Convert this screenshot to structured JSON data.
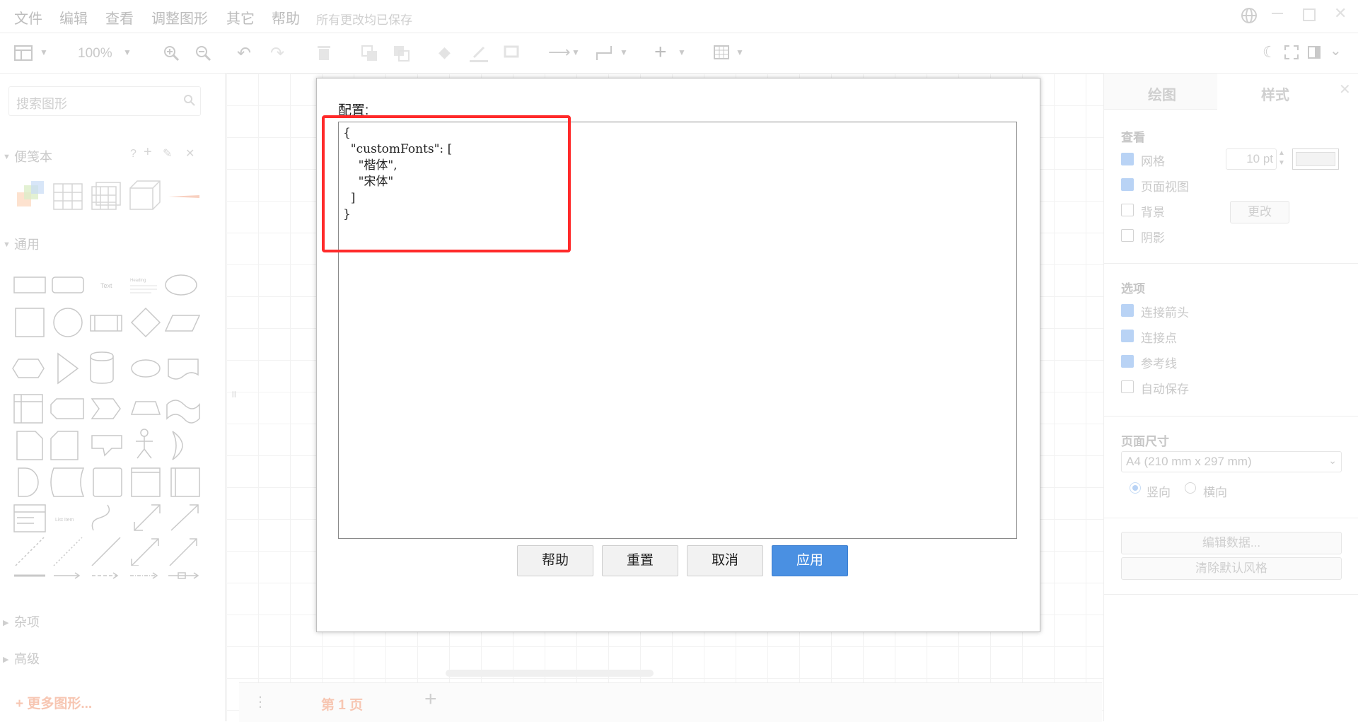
{
  "menubar": {
    "items": [
      "文件",
      "编辑",
      "查看",
      "调整图形",
      "其它",
      "帮助"
    ],
    "status": "所有更改均已保存"
  },
  "toolbar": {
    "zoom": "100%"
  },
  "left_panel": {
    "search_placeholder": "搜索图形",
    "sections": {
      "scratchpad": "便笺本",
      "general": "通用",
      "misc": "杂项",
      "advanced": "高级"
    },
    "scratchpad_help": "?",
    "shape_text": "Text",
    "shape_heading": "Heading",
    "shape_list_item": "List Item",
    "more_shapes": "+ 更多图形..."
  },
  "page_tabs": {
    "current": "第 1 页"
  },
  "right_panel": {
    "tabs": [
      "绘图",
      "样式"
    ],
    "view": {
      "title": "查看",
      "grid": "网格",
      "grid_size": "10 pt",
      "page_view": "页面视图",
      "background": "背景",
      "change_button": "更改",
      "shadow": "阴影"
    },
    "options": {
      "title": "选项",
      "connection_arrows": "连接箭头",
      "connection_points": "连接点",
      "guides": "参考线",
      "autosave": "自动保存"
    },
    "page_size": {
      "title": "页面尺寸",
      "value": "A4 (210 mm x 297 mm)",
      "portrait": "竖向",
      "landscape": "横向"
    },
    "edit_data": "编辑数据...",
    "clear_default_style": "清除默认风格"
  },
  "dialog": {
    "label": "配置:",
    "config_text": "{\n  \"customFonts\": [\n    \"楷体\",\n    \"宋体\"\n  ]\n}",
    "buttons": {
      "help": "帮助",
      "reset": "重置",
      "cancel": "取消",
      "apply": "应用"
    }
  },
  "colors": {
    "highlight": "#ff2a2a",
    "apply_button": "#4a90e2"
  }
}
